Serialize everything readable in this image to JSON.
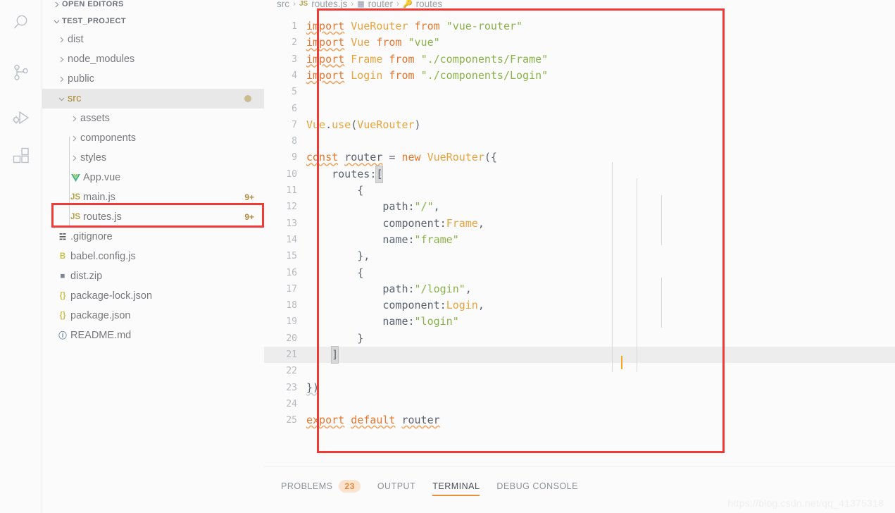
{
  "activity_bar": {
    "icons": [
      {
        "name": "search-icon",
        "label": "Search"
      },
      {
        "name": "source-control-icon",
        "label": "Source Control"
      },
      {
        "name": "run-and-debug-icon",
        "label": "Run and Debug"
      },
      {
        "name": "extensions-icon",
        "label": "Extensions"
      }
    ]
  },
  "sidebar": {
    "open_editors_label": "OPEN EDITORS",
    "project_label": "TEST_PROJECT",
    "tree": [
      {
        "label": "dist",
        "type": "folder",
        "expanded": false,
        "depth": 1,
        "icon": "",
        "badge": ""
      },
      {
        "label": "node_modules",
        "type": "folder",
        "expanded": false,
        "depth": 1,
        "icon": "",
        "badge": ""
      },
      {
        "label": "public",
        "type": "folder",
        "expanded": false,
        "depth": 1,
        "icon": "",
        "badge": ""
      },
      {
        "label": "src",
        "type": "folder",
        "expanded": true,
        "depth": 1,
        "icon": "",
        "badge": "",
        "selected": true,
        "dot": true
      },
      {
        "label": "assets",
        "type": "folder",
        "expanded": false,
        "depth": 2,
        "icon": "",
        "badge": ""
      },
      {
        "label": "components",
        "type": "folder",
        "expanded": false,
        "depth": 2,
        "icon": "",
        "badge": ""
      },
      {
        "label": "styles",
        "type": "folder",
        "expanded": false,
        "depth": 2,
        "icon": "",
        "badge": ""
      },
      {
        "label": "App.vue",
        "type": "file",
        "depth": 2,
        "icon": "vue-file-icon",
        "icon_text": "V",
        "icon_color": "#41b883",
        "badge": ""
      },
      {
        "label": "main.js",
        "type": "file",
        "depth": 2,
        "icon": "js-file-icon",
        "icon_text": "JS",
        "icon_color": "#b3a14a",
        "badge": "9+"
      },
      {
        "label": "routes.js",
        "type": "file",
        "depth": 2,
        "icon": "js-file-icon",
        "icon_text": "JS",
        "icon_color": "#b3a14a",
        "badge": "9+",
        "annotated": true
      },
      {
        "label": ".gitignore",
        "type": "file",
        "depth": 1,
        "icon": "git-file-icon",
        "icon_text": "☵",
        "icon_color": "#4a4a4a",
        "badge": ""
      },
      {
        "label": "babel.config.js",
        "type": "file",
        "depth": 1,
        "icon": "babel-file-icon",
        "icon_text": "B",
        "icon_color": "#cbbf4a",
        "badge": ""
      },
      {
        "label": "dist.zip",
        "type": "file",
        "depth": 1,
        "icon": "zip-file-icon",
        "icon_text": "■",
        "icon_color": "#7b8794",
        "badge": ""
      },
      {
        "label": "package-lock.json",
        "type": "file",
        "depth": 1,
        "icon": "json-file-icon",
        "icon_text": "{}",
        "icon_color": "#c9c04f",
        "badge": ""
      },
      {
        "label": "package.json",
        "type": "file",
        "depth": 1,
        "icon": "json-file-icon",
        "icon_text": "{}",
        "icon_color": "#c9c04f",
        "badge": ""
      },
      {
        "label": "README.md",
        "type": "file",
        "depth": 1,
        "icon": "info-file-icon",
        "icon_text": "ⓘ",
        "icon_color": "#6f8ba8",
        "badge": ""
      }
    ]
  },
  "editor": {
    "breadcrumb": [
      {
        "label": "src",
        "icon": ""
      },
      {
        "label": "routes.js",
        "icon": "js-file-icon"
      },
      {
        "label": "router",
        "icon": "variable-icon"
      },
      {
        "label": "routes",
        "icon": "property-icon"
      }
    ],
    "active_line": 21,
    "total_lines": 25,
    "lines": [
      {
        "n": 1,
        "text": "import VueRouter from \"vue-router\""
      },
      {
        "n": 2,
        "text": "import Vue from \"vue\""
      },
      {
        "n": 3,
        "text": "import Frame from \"./components/Frame\""
      },
      {
        "n": 4,
        "text": "import Login from \"./components/Login\""
      },
      {
        "n": 5,
        "text": ""
      },
      {
        "n": 6,
        "text": ""
      },
      {
        "n": 7,
        "text": "Vue.use(VueRouter)"
      },
      {
        "n": 8,
        "text": ""
      },
      {
        "n": 9,
        "text": "const router = new VueRouter({"
      },
      {
        "n": 10,
        "text": "    routes:["
      },
      {
        "n": 11,
        "text": "        {"
      },
      {
        "n": 12,
        "text": "            path:\"/\","
      },
      {
        "n": 13,
        "text": "            component:Frame,"
      },
      {
        "n": 14,
        "text": "            name:\"frame\""
      },
      {
        "n": 15,
        "text": "        },"
      },
      {
        "n": 16,
        "text": "        {"
      },
      {
        "n": 17,
        "text": "            path:\"/login\","
      },
      {
        "n": 18,
        "text": "            component:Login,"
      },
      {
        "n": 19,
        "text": "            name:\"login\""
      },
      {
        "n": 20,
        "text": "        }"
      },
      {
        "n": 21,
        "text": "    ]"
      },
      {
        "n": 22,
        "text": ""
      },
      {
        "n": 23,
        "text": "})"
      },
      {
        "n": 24,
        "text": ""
      },
      {
        "n": 25,
        "text": "export default router"
      }
    ]
  },
  "panel": {
    "tabs": [
      {
        "label": "PROBLEMS",
        "count": "23",
        "active": false
      },
      {
        "label": "OUTPUT",
        "count": "",
        "active": false
      },
      {
        "label": "TERMINAL",
        "count": "",
        "active": true
      },
      {
        "label": "DEBUG CONSOLE",
        "count": "",
        "active": false
      }
    ]
  },
  "watermark": "https://blog.csdn.net/qq_41375318",
  "colors": {
    "accent": "#e8913c",
    "annotation": "#ee3b36",
    "keyword": "#e8762c",
    "string": "#8ab349",
    "selected_row": "#e8e8e8"
  }
}
